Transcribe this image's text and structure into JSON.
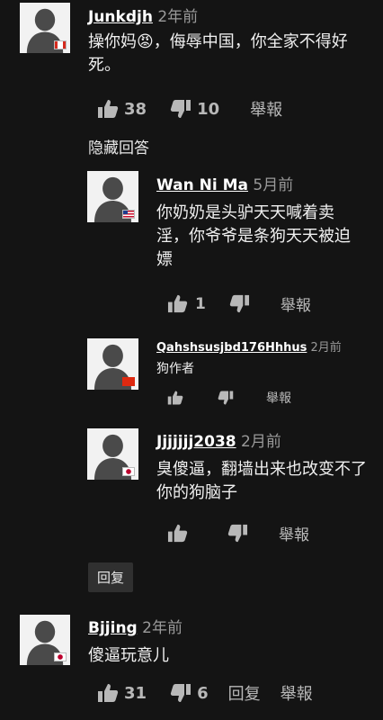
{
  "comments": [
    {
      "author": "Junkdjh",
      "time": "2年前",
      "text": "操你妈😡，侮辱中国，你全家不得好死。",
      "likes": "38",
      "dislikes": "10",
      "report": "舉報",
      "flag": "canada"
    },
    {
      "author": "Wan Ni Ma",
      "time": "5月前",
      "text": "你奶奶是头驴天天喊着卖淫，你爷爷是条狗天天被迫嫖",
      "likes": "1",
      "report": "舉報",
      "flag": "usa"
    },
    {
      "author": "Qahshsusjbd176Hhhus",
      "time": "2月前",
      "text": "狗作者",
      "report": "舉報",
      "flag": "hongkong"
    },
    {
      "author": "Jjjjjjj2038",
      "time": "2月前",
      "text": "臭傻逼，翻墙出来也改变不了你的狗脑子",
      "report": "舉報",
      "flag": "japan"
    },
    {
      "author": "Bjjing",
      "time": "2年前",
      "text": "傻逼玩意儿",
      "likes": "31",
      "dislikes": "6",
      "reply": "回复",
      "report": "舉報",
      "flag": "japan"
    }
  ],
  "hide_replies": "隐藏回答",
  "reply_button": "回复",
  "icons": {
    "like": "thumbs-up-icon",
    "dislike": "thumbs-down-icon"
  },
  "colors": {
    "background": "#141414",
    "avatar_bg": "#f2f2f2",
    "silhouette": "#4a4a4a",
    "reply_button_bg": "#303030"
  }
}
